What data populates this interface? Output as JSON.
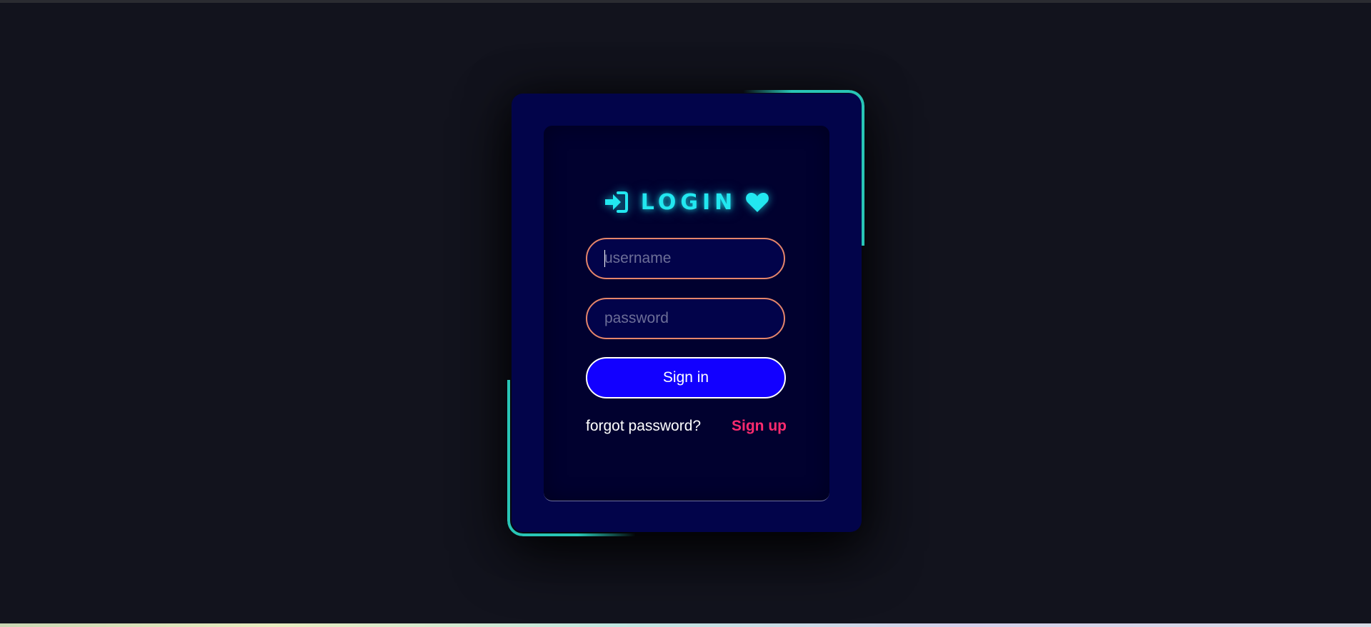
{
  "login_form": {
    "title": "LOGIN",
    "title_icon_left": "sign-in-icon",
    "title_icon_right": "heart-icon",
    "username": {
      "value": "",
      "placeholder": "username"
    },
    "password": {
      "value": "",
      "placeholder": "password"
    },
    "signin_label": "Sign in",
    "forgot_label": "forgot password?",
    "signup_label": "Sign up"
  },
  "colors": {
    "page_background": "#12131d",
    "card_background": "#02044a",
    "inner_panel": "#01012f",
    "accent_cyan": "#22e7f0",
    "frame_teal": "#28c5b6",
    "input_border": "#e5856b",
    "button_blue": "#1200ff",
    "signup_pink": "#ff2b6f"
  }
}
